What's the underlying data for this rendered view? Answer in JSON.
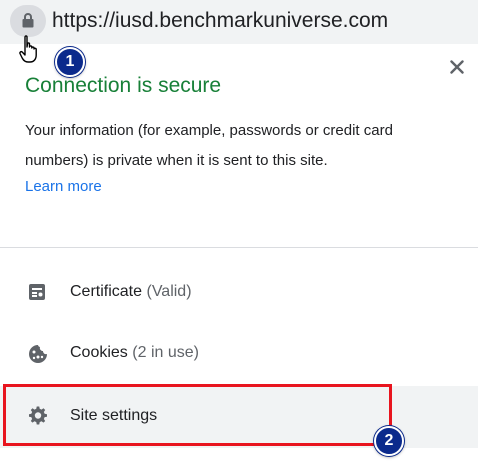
{
  "address_bar": {
    "url": "https://iusd.benchmarkuniverse.com",
    "icon": "lock-icon"
  },
  "annotations": {
    "step1": "1",
    "step2": "2"
  },
  "popup": {
    "title": "Connection is secure",
    "info": "Your information (for example, passwords or credit card numbers) is private when it is sent to this site.",
    "learn_more": "Learn more",
    "close_icon": "close-icon"
  },
  "menu": {
    "certificate": {
      "label": "Certificate",
      "note": "(Valid)",
      "icon": "certificate-icon"
    },
    "cookies": {
      "label": "Cookies",
      "note": "(2 in use)",
      "icon": "cookie-icon"
    },
    "site_settings": {
      "label": "Site settings",
      "icon": "gear-icon"
    }
  },
  "colors": {
    "secure_green": "#188038",
    "link_blue": "#1a73e8",
    "highlight_red": "#e8141e",
    "badge_navy": "#0b2a8c"
  }
}
